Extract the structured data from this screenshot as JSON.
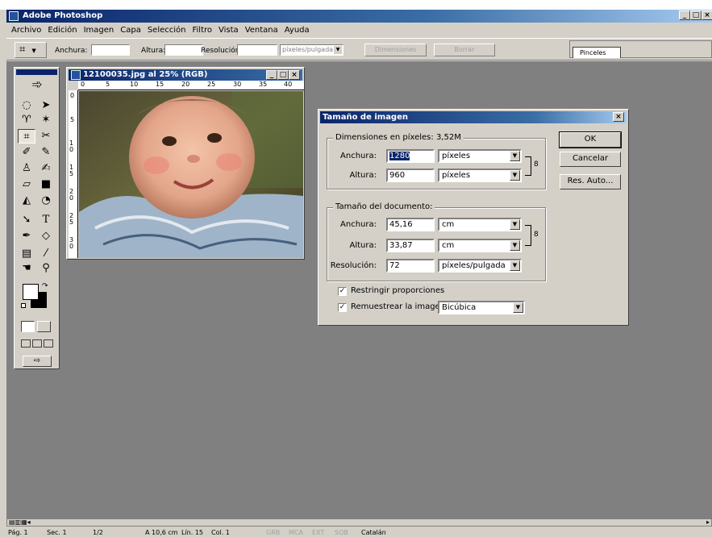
{
  "app": {
    "title": "Adobe Photoshop",
    "window_buttons": [
      "_",
      "□",
      "×"
    ]
  },
  "menu": [
    "Archivo",
    "Edición",
    "Imagen",
    "Capa",
    "Selección",
    "Filtro",
    "Vista",
    "Ventana",
    "Ayuda"
  ],
  "options": {
    "width_label": "Anchura:",
    "height_label": "Altura:",
    "resolution_label": "Resolución:",
    "resolution_unit": "píxeles/pulgada",
    "dimensions_button": "Dimensiones",
    "clear_button": "Borrar",
    "palette_tab": "Pinceles"
  },
  "document": {
    "title": "12100035.jpg al 25% (RGB)",
    "ruler_top": [
      "0",
      "5",
      "10",
      "15",
      "20",
      "25",
      "30",
      "35",
      "40"
    ],
    "ruler_left": [
      "0",
      "5",
      "1 0",
      "1 5",
      "2 0",
      "2 5",
      "3 0"
    ]
  },
  "dialog": {
    "title": "Tamaño de imagen",
    "pixel_group": "Dimensiones en píxeles: 3,52M",
    "px_width_label": "Anchura:",
    "px_width_value": "1280",
    "px_width_unit": "píxeles",
    "px_height_label": "Altura:",
    "px_height_value": "960",
    "px_height_unit": "píxeles",
    "doc_group": "Tamaño del documento:",
    "doc_width_label": "Anchura:",
    "doc_width_value": "45,16",
    "doc_width_unit": "cm",
    "doc_height_label": "Altura:",
    "doc_height_value": "33,87",
    "doc_height_unit": "cm",
    "resolution_label": "Resolución:",
    "resolution_value": "72",
    "resolution_unit": "píxeles/pulgada",
    "constrain_label": "Restringir proporciones",
    "constrain_checked": true,
    "resample_label": "Remuestrear la imagen:",
    "resample_checked": true,
    "resample_method": "Bicúbica",
    "ok": "OK",
    "cancel": "Cancelar",
    "auto": "Res. Auto..."
  },
  "statusbar": {
    "items": [
      "Pág. 1",
      "Sec. 1",
      "1/2",
      "A 10,6 cm",
      "Lín. 15",
      "Col. 1",
      "GRB",
      "MCA",
      "EXT",
      "SOB",
      "Catalán"
    ]
  },
  "colors": {
    "title_active": "#0a246a",
    "workspace": "#808080",
    "chrome": "#d4d0c8"
  }
}
